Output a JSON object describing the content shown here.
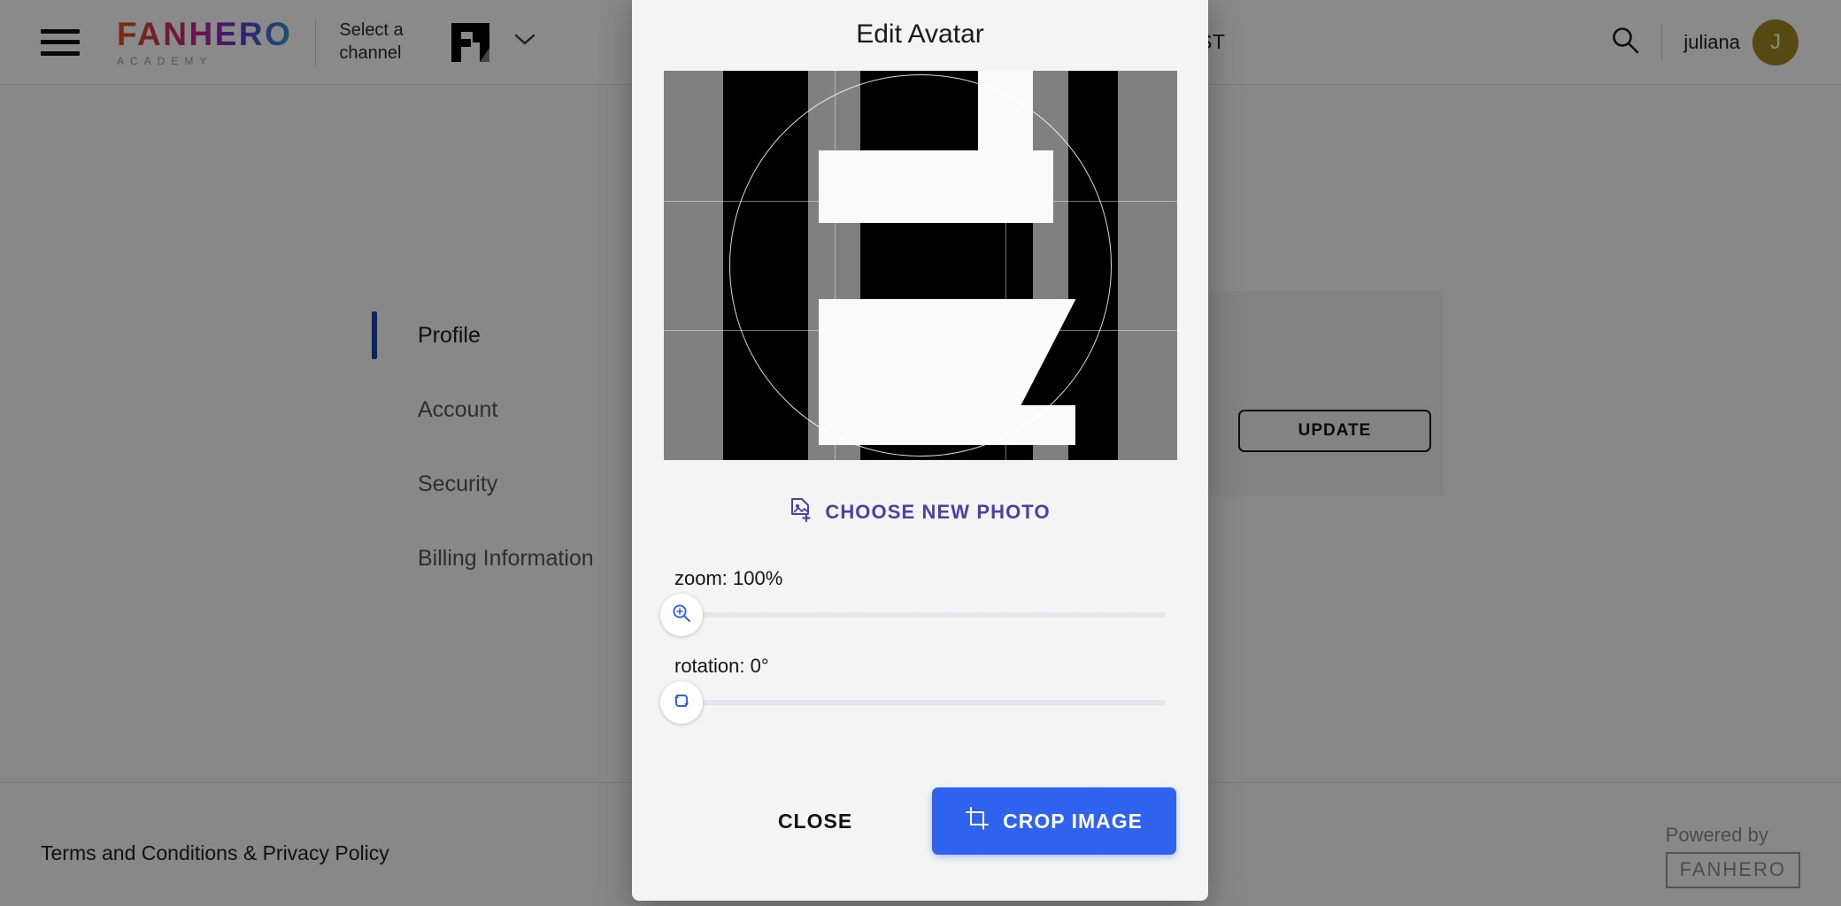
{
  "topbar": {
    "menu_icon": "hamburger-icon",
    "brand_word": "FANHERO",
    "brand_sub": "ACADEMY",
    "channel_selector_label": "Select a channel",
    "channel_mark": "fh-logo-mark",
    "chevron_icon": "chevron-down-icon",
    "list_label": "LIST",
    "search_icon": "search-icon",
    "user_name": "juliana",
    "avatar_initial": "J",
    "avatar_color": "#a08a22"
  },
  "sidebar": {
    "items": [
      {
        "label": "Profile",
        "active": true
      },
      {
        "label": "Account",
        "active": false
      },
      {
        "label": "Security",
        "active": false
      },
      {
        "label": "Billing Information",
        "active": false
      }
    ],
    "active_indicator_color": "#1b3fb5"
  },
  "main": {
    "update_button_label": "UPDATE"
  },
  "footer": {
    "terms_link": "Terms and Conditions & Privacy Policy",
    "powered_by_text": "Powered by",
    "powered_by_brand": "FANHERO"
  },
  "modal": {
    "title": "Edit Avatar",
    "choose_photo_label": "CHOOSE NEW PHOTO",
    "choose_photo_icon": "add-photo-icon",
    "choose_photo_color": "#4b3fa8",
    "zoom": {
      "label": "zoom: 100%",
      "value": 100,
      "unit": "%",
      "min": 100,
      "max": 300,
      "thumb_icon": "zoom-in-icon",
      "thumb_color": "#2f62ef"
    },
    "rotation": {
      "label": "rotation: 0°",
      "value": 0,
      "unit": "°",
      "min": 0,
      "max": 360,
      "thumb_icon": "rotate-icon",
      "thumb_color": "#2f62ef"
    },
    "close_label": "CLOSE",
    "crop_label": "CROP IMAGE",
    "crop_icon": "crop-icon",
    "crop_button_color": "#2f62ef",
    "crop_preview": {
      "alt": "FanHero FH logo, white on black with gray letterbox bars",
      "overlay_shape": "circle",
      "grid": "rule-of-thirds"
    }
  }
}
